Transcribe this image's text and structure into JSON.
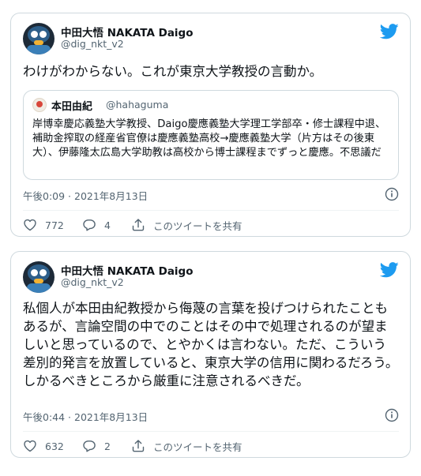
{
  "tweets": [
    {
      "author_name": "中田大悟 NAKATA Daigo",
      "author_handle": "@dig_nkt_v2",
      "text": "わけがわからない。これが東京大学教授の言動か。",
      "quote": {
        "author_name": "本田由紀",
        "author_handle": "@hahaguma",
        "text": "岸博幸慶応義塾大学教授、Daigo慶應義塾大学理工学部卒・修士課程中退、補助金搾取の経産省官僚は慶應義塾高校→慶應義塾大学（片方はその後東大）、伊藤隆太広島大学助教は高校から博士課程までずっと慶應。不思議だ"
      },
      "timestamp": "午後0:09 · 2021年8月13日",
      "likes": "772",
      "replies": "4",
      "share_label": "このツイートを共有"
    },
    {
      "author_name": "中田大悟 NAKATA Daigo",
      "author_handle": "@dig_nkt_v2",
      "text": "私個人が本田由紀教授から侮蔑の言葉を投げつけられたこともあるが、言論空間の中でのことはその中で処理されるのが望ましいと思っているので、とやかくは言わない。ただ、こういう差別的発言を放置していると、東京大学の信用に関わるだろう。しかるべきところから厳重に注意されるべきだ。",
      "timestamp": "午後0:44 · 2021年8月13日",
      "likes": "632",
      "replies": "2",
      "share_label": "このツイートを共有"
    }
  ],
  "colors": {
    "brand_blue": "#1d9bf0",
    "secondary_text": "#536471",
    "border": "#cfd9de"
  },
  "icons": [
    "twitter-bird-icon",
    "info-icon",
    "heart-icon",
    "reply-icon",
    "share-icon"
  ]
}
